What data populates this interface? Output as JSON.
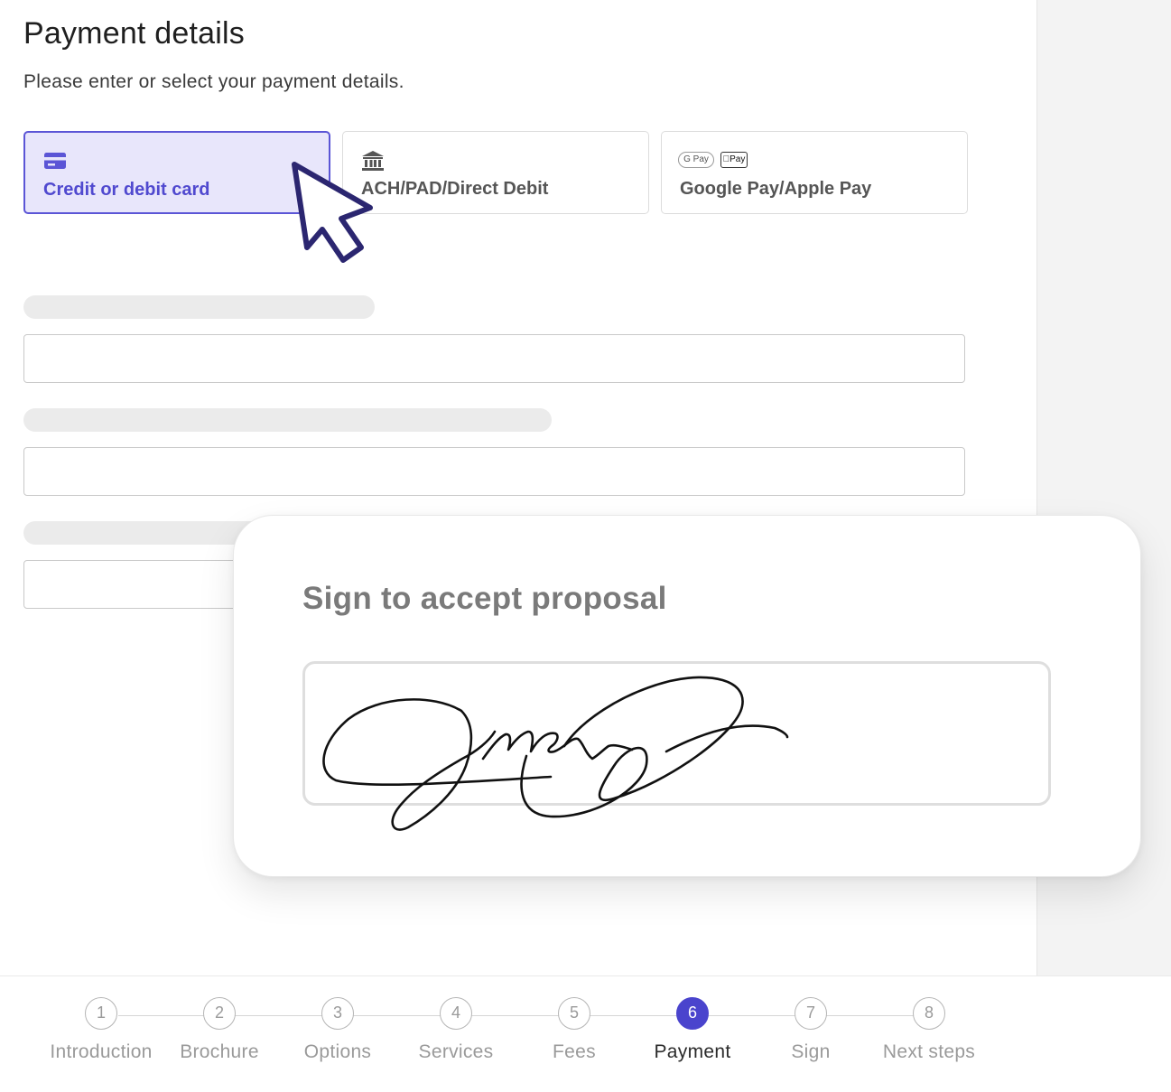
{
  "page": {
    "title": "Payment details",
    "subtitle": "Please enter or select your payment details."
  },
  "payment_methods": [
    {
      "label": "Credit or debit card",
      "icon": "credit-card-icon",
      "selected": true
    },
    {
      "label": "ACH/PAD/Direct Debit",
      "icon": "bank-icon",
      "selected": false
    },
    {
      "label": "Google Pay/Apple Pay",
      "icons": [
        "G Pay",
        "Pay"
      ],
      "selected": false
    }
  ],
  "sign": {
    "title": "Sign to accept proposal"
  },
  "steps": [
    {
      "number": "1",
      "label": "Introduction"
    },
    {
      "number": "2",
      "label": "Brochure"
    },
    {
      "number": "3",
      "label": "Options"
    },
    {
      "number": "4",
      "label": "Services"
    },
    {
      "number": "5",
      "label": "Fees"
    },
    {
      "number": "6",
      "label": "Payment",
      "active": true
    },
    {
      "number": "7",
      "label": "Sign"
    },
    {
      "number": "8",
      "label": "Next steps"
    }
  ],
  "colors": {
    "accent": "#4a44cd",
    "selected_bg": "#e8e6fb",
    "skeleton": "#ebebeb"
  }
}
